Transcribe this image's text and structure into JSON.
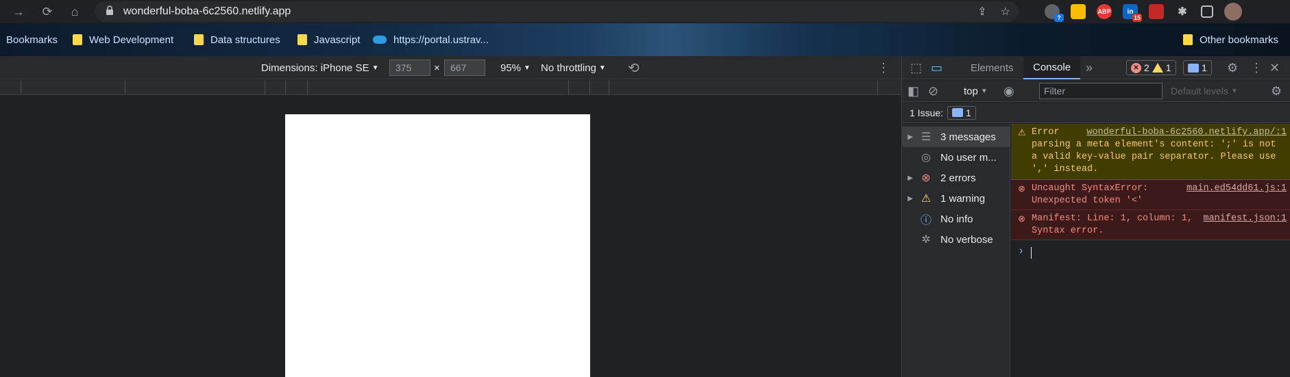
{
  "browser": {
    "url": "wonderful-boba-6c2560.netlify.app",
    "extensions": [
      {
        "name": "chat-extension-icon",
        "badge": "?",
        "color": "#5f6368",
        "badge_color": "#1a73e8"
      },
      {
        "name": "keep-extension-icon",
        "badge": "",
        "color": "#fbbc04",
        "badge_color": ""
      },
      {
        "name": "adblock-extension-icon",
        "label": "ABP",
        "badge": "",
        "color": "#e53935",
        "badge_color": ""
      },
      {
        "name": "linkedin-extension-icon",
        "label": "in",
        "badge": "15",
        "color": "#0a66c2",
        "badge_color": "#d93025"
      },
      {
        "name": "bookmark-extension-icon",
        "badge": "",
        "color": "#c62828",
        "badge_color": ""
      }
    ]
  },
  "bookmarks": {
    "items": [
      "Bookmarks",
      "Web Development",
      "Data structures",
      "Javascript",
      "https://portal.ustrav..."
    ],
    "other": "Other bookmarks"
  },
  "device_toolbar": {
    "dimensions_label": "Dimensions: iPhone SE",
    "width": "375",
    "height": "667",
    "times": "×",
    "zoom": "95%",
    "throttling": "No throttling"
  },
  "devtools": {
    "tabs": {
      "elements": "Elements",
      "console": "Console"
    },
    "counts": {
      "errors": "2",
      "warnings": "1",
      "info": "1"
    },
    "context": "top",
    "filter_placeholder": "Filter",
    "levels": "Default levels",
    "issues_label": "1 Issue:",
    "issues_count": "1",
    "sidebar": [
      {
        "label": "3 messages",
        "icon": "list-icon"
      },
      {
        "label": "No user m...",
        "icon": "user-icon"
      },
      {
        "label": "2 errors",
        "icon": "error-icon"
      },
      {
        "label": "1 warning",
        "icon": "warning-icon"
      },
      {
        "label": "No info",
        "icon": "info-icon"
      },
      {
        "label": "No verbose",
        "icon": "bug-icon"
      }
    ],
    "messages": [
      {
        "type": "warning",
        "text": "Error parsing a meta element's content: ';' is not a valid key-value pair separator. Please use ',' instead.",
        "source": "wonderful-boba-6c2560.netlify.app/:1"
      },
      {
        "type": "error",
        "text": "Uncaught SyntaxError: Unexpected token '<'",
        "source": "main.ed54dd61.js:1"
      },
      {
        "type": "error",
        "text": "Manifest: Line: 1, column: 1, Syntax error.",
        "source": "manifest.json:1"
      }
    ]
  }
}
